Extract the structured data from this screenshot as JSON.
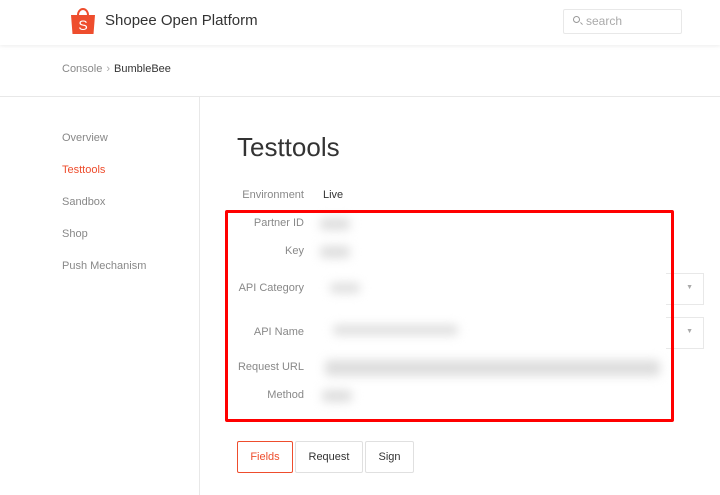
{
  "header": {
    "brand": "Shopee Open Platform",
    "search_placeholder": "search",
    "accent": "#ee4d2d"
  },
  "breadcrumb": {
    "root": "Console",
    "separator": ">",
    "current": "BumbleBee"
  },
  "sidebar": {
    "items": [
      {
        "label": "Overview"
      },
      {
        "label": "Testtools",
        "active": true
      },
      {
        "label": "Sandbox"
      },
      {
        "label": "Shop"
      },
      {
        "label": "Push Mechanism"
      }
    ]
  },
  "main": {
    "title": "Testtools",
    "environment_label": "Environment",
    "environment_value": "Live",
    "fields": {
      "partner_id": "Partner ID",
      "key": "Key",
      "api_category": "API Category",
      "api_name": "API Name",
      "request_url": "Request URL",
      "method": "Method"
    },
    "tabs": [
      {
        "label": "Fields",
        "active": true
      },
      {
        "label": "Request"
      },
      {
        "label": "Sign"
      }
    ]
  }
}
